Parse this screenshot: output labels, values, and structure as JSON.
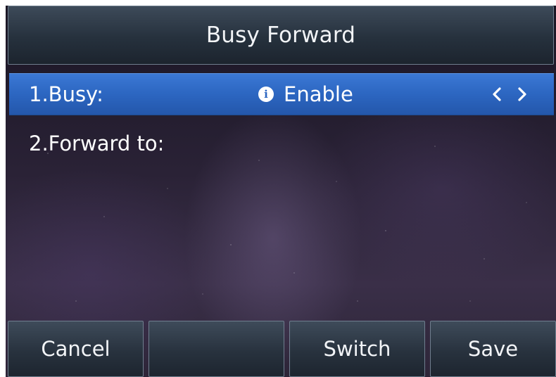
{
  "header": {
    "title": "Busy Forward"
  },
  "settings": [
    {
      "label": "1.Busy:",
      "value": "Enable",
      "icon": "info-icon",
      "selected": true
    },
    {
      "label": "2.Forward to:",
      "value": "",
      "selected": false
    }
  ],
  "softkeys": {
    "cancel": "Cancel",
    "empty": "",
    "switch": "Switch",
    "save": "Save"
  },
  "colors": {
    "selection": "#2c66c1",
    "titlebar": "#26313d",
    "background": "#2a2236"
  }
}
